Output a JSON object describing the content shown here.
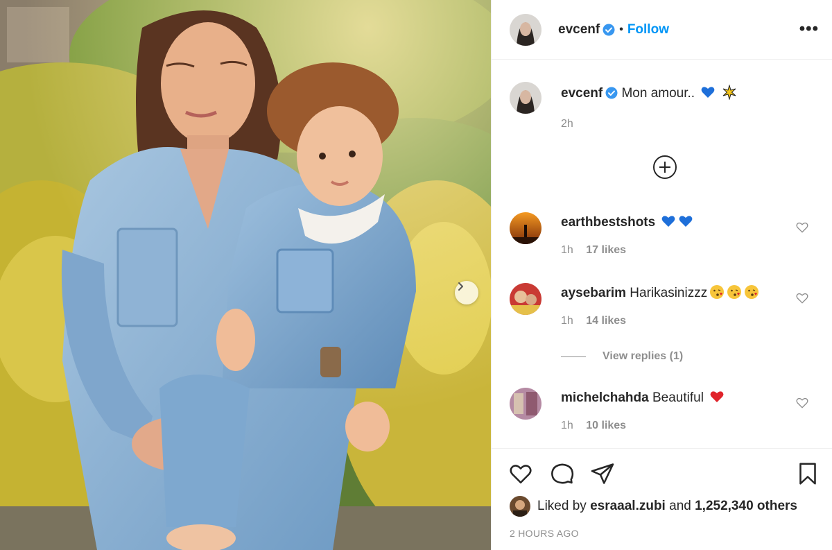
{
  "post": {
    "author": "evcenf",
    "follow_label": "Follow",
    "separator": "•",
    "more_label": "•••",
    "caption": {
      "username": "evcenf",
      "text": "Mon amour..",
      "time": "2h"
    }
  },
  "comments": [
    {
      "username": "earthbestshots",
      "text": "",
      "emoji": [
        "blue-heart",
        "blue-heart"
      ],
      "time": "1h",
      "likes": "17 likes"
    },
    {
      "username": "aysebarim",
      "text": "Harikasinizzz",
      "emoji": [
        "kiss-face",
        "kiss-face",
        "kiss-face"
      ],
      "time": "1h",
      "likes": "14 likes"
    },
    {
      "username": "michelchahda",
      "text": "Beautiful",
      "emoji": [
        "red-heart"
      ],
      "time": "1h",
      "likes": "10 likes"
    }
  ],
  "view_replies": "View replies (1)",
  "likes": {
    "prefix": "Liked by",
    "user": "esraaal.zubi",
    "middle": "and",
    "count": "1,252,340 others"
  },
  "posted_ago": "2 HOURS AGO",
  "icons": {
    "like": "heart-outline-icon",
    "comment": "comment-bubble-icon",
    "share": "paper-plane-icon",
    "save": "bookmark-icon",
    "verified": "verified-badge-icon",
    "load_more": "plus-circle-icon",
    "next": "chevron-right-icon"
  },
  "colors": {
    "accent": "#0095f6",
    "muted": "#8e8e8e",
    "text": "#262626",
    "border": "#efefef",
    "blue_heart": "#1e6fd9",
    "red_heart": "#e0242b"
  }
}
